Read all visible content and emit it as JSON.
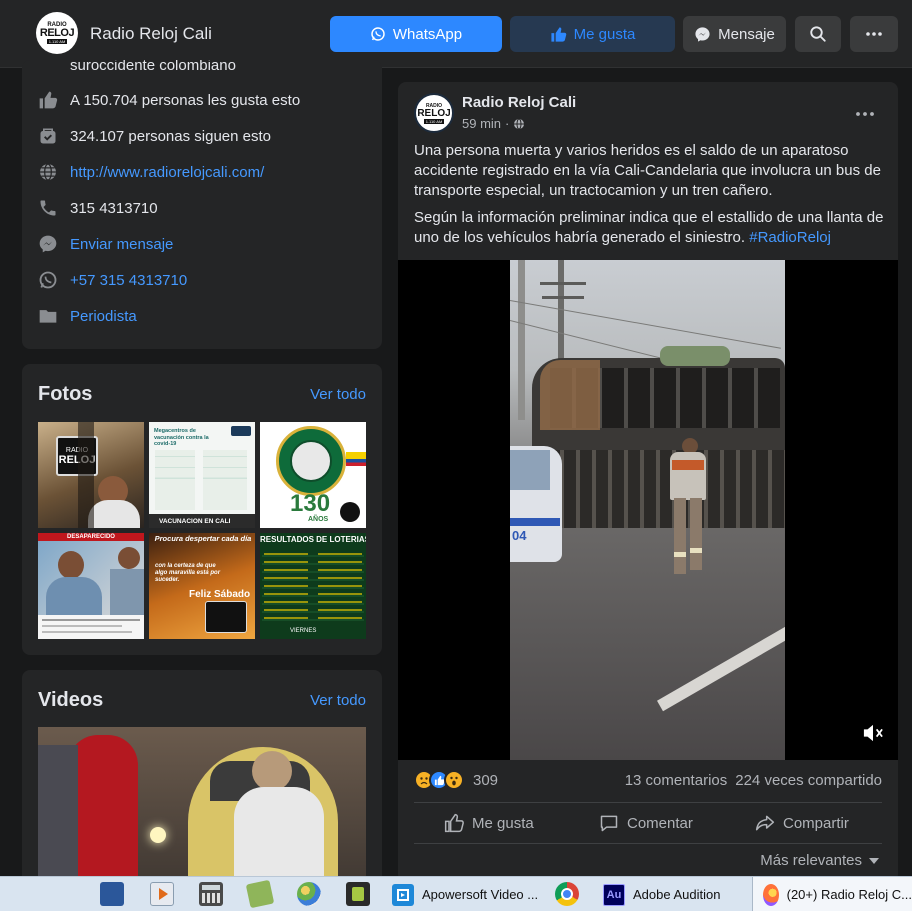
{
  "header": {
    "logo": {
      "line1": "RADIO",
      "line2": "RELOJ",
      "line3": "1.110 AM"
    },
    "page_name": "Radio Reloj Cali",
    "whatsapp_label": "WhatsApp",
    "like_label": "Me gusta",
    "message_label": "Mensaje"
  },
  "about": {
    "cut_text": "suroccidente colombiano",
    "likes": "A 150.704 personas les gusta esto",
    "followers": "324.107 personas siguen esto",
    "website": "http://www.radiorelojcali.com/",
    "phone": "315 4313710",
    "send_message": "Enviar mensaje",
    "whatsapp": "+57 315 4313710",
    "category": "Periodista"
  },
  "photos": {
    "title": "Fotos",
    "see_all": "Ver todo",
    "items": [
      {
        "text1": "RADIO",
        "text2": "RELOJ"
      },
      {
        "text1": "Megacentros de vacunación contra la covid-19",
        "text2": "VACUNACION EN CALI"
      },
      {
        "text1": "130",
        "text2": "AÑOS"
      },
      {
        "text1": "DESAPARECIDO",
        "text2": ""
      },
      {
        "text1": "Procura despertar cada día",
        "text2": "con la certeza de que algo maravilla está por suceder.",
        "text3": "Feliz Sábado"
      },
      {
        "text1": "RESULTADOS DE LOTERIAS",
        "text2": "VIERNES"
      }
    ]
  },
  "videos": {
    "title": "Videos",
    "see_all": "Ver todo"
  },
  "post": {
    "author": "Radio Reloj Cali",
    "time": "59 min",
    "paragraph1": "Una persona muerta y varios heridos es el saldo de un aparatoso accidente registrado en la vía Cali-Candelaria que involucra un bus de transporte especial, un tractocamion y un tren cañero.",
    "paragraph2": "Según la información preliminar indica que el estallido de una llanta de uno de los vehículos habría generado el siniestro.",
    "hashtag": "#RadioReloj",
    "bus_number": "04",
    "reaction_count": "309",
    "comments": "13 comentarios",
    "shares": "224 veces compartido",
    "action_like": "Me gusta",
    "action_comment": "Comentar",
    "action_share": "Compartir",
    "sort_label": "Más relevantes"
  },
  "taskbar": {
    "apowersoft": "Apowersoft Video ...",
    "audition": "Adobe Audition",
    "firefox": "(20+) Radio Reloj C...",
    "audition_icon": "Au"
  },
  "colors": {
    "accent": "#2d88ff",
    "link": "#4599ff",
    "card": "#242526",
    "background": "#18191a"
  }
}
